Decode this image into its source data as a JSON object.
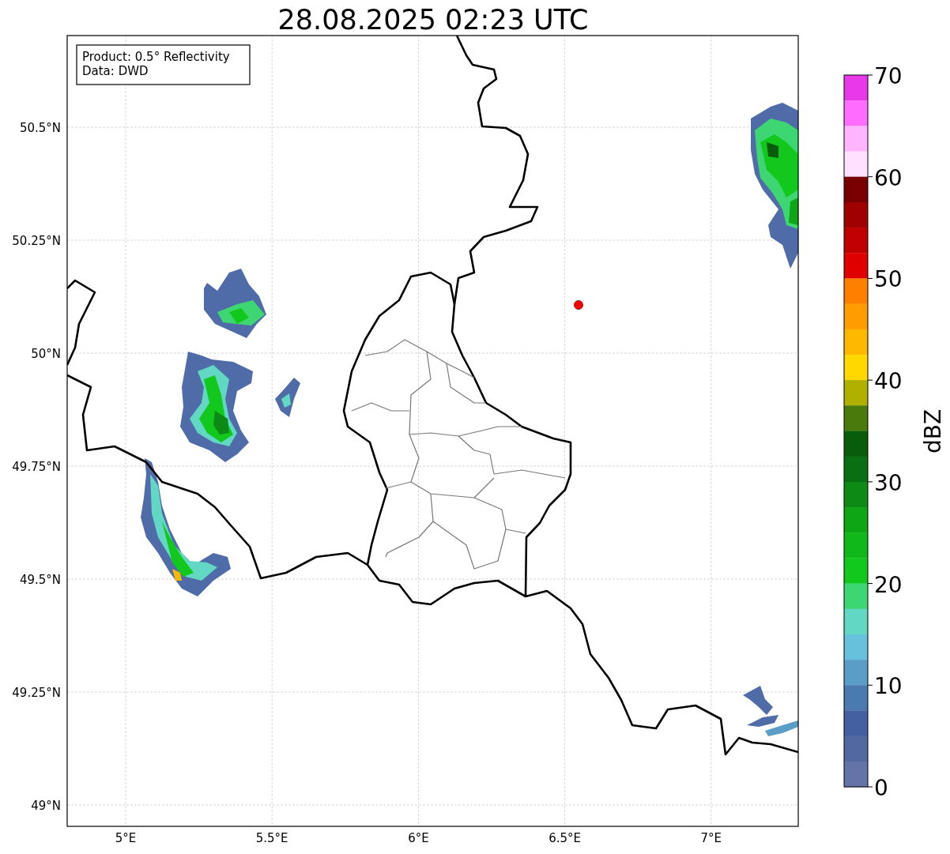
{
  "title": "28.08.2025 02:23 UTC",
  "legend": [
    "Product: 0.5° Reflectivity",
    "Data: DWD"
  ],
  "latitude_ticks": [
    "50.5°N",
    "50.25°N",
    "50°N",
    "49.75°N",
    "49.5°N",
    "49.25°N",
    "49°N"
  ],
  "longitude_ticks": [
    "5°E",
    "5.5°E",
    "6°E",
    "6.5°E",
    "7°E"
  ],
  "colorbar": {
    "label": "dBZ",
    "ticks": [
      "70",
      "60",
      "50",
      "40",
      "30",
      "20",
      "10",
      "0"
    ],
    "segments": [
      {
        "color": "#e839e8"
      },
      {
        "color": "#ff6cff"
      },
      {
        "color": "#ffb4ff"
      },
      {
        "color": "#ffe0ff"
      },
      {
        "color": "#780000"
      },
      {
        "color": "#a00000"
      },
      {
        "color": "#c00000"
      },
      {
        "color": "#e00000"
      },
      {
        "color": "#ff8000"
      },
      {
        "color": "#ff9c00"
      },
      {
        "color": "#ffb800"
      },
      {
        "color": "#ffd800"
      },
      {
        "color": "#b0b000"
      },
      {
        "color": "#4a7a0c"
      },
      {
        "color": "#085c0c"
      },
      {
        "color": "#0a6e12"
      },
      {
        "color": "#0c8a15"
      },
      {
        "color": "#0fa615"
      },
      {
        "color": "#10b81a"
      },
      {
        "color": "#12c81c"
      },
      {
        "color": "#3dd672"
      },
      {
        "color": "#62d8c4"
      },
      {
        "color": "#66c2dc"
      },
      {
        "color": "#5a9ec8"
      },
      {
        "color": "#4a7ab0"
      },
      {
        "color": "#4460a0"
      },
      {
        "color": "#5268a0"
      },
      {
        "color": "#6474a8"
      }
    ]
  }
}
